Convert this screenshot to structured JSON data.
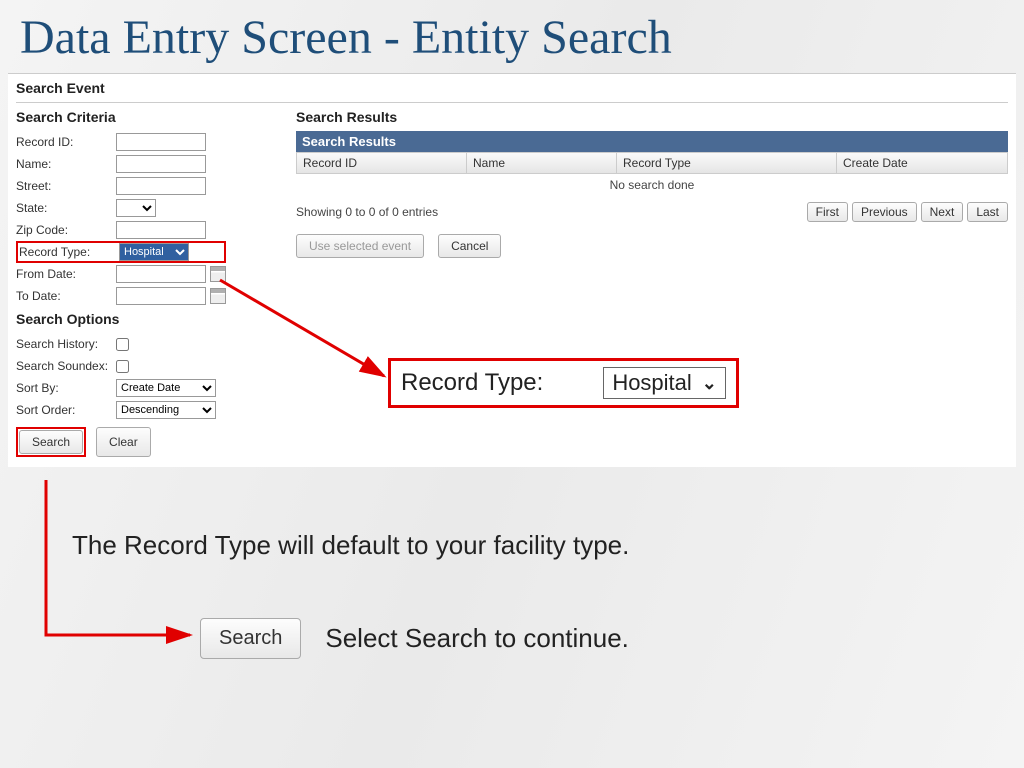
{
  "slide": {
    "title": "Data Entry Screen - Entity Search"
  },
  "panel": {
    "title": "Search Event",
    "criteria": {
      "heading": "Search Criteria",
      "record_id": "Record ID:",
      "name": "Name:",
      "street": "Street:",
      "state": "State:",
      "zip": "Zip Code:",
      "record_type": "Record Type:",
      "record_type_value": "Hospital",
      "from_date": "From Date:",
      "to_date": "To Date:"
    },
    "options": {
      "heading": "Search Options",
      "history": "Search History:",
      "soundex": "Search Soundex:",
      "sort_by": "Sort By:",
      "sort_by_value": "Create Date",
      "sort_order": "Sort Order:",
      "sort_order_value": "Descending"
    },
    "buttons": {
      "search": "Search",
      "clear": "Clear"
    },
    "results": {
      "heading": "Search Results",
      "bar": "Search Results",
      "cols": {
        "id": "Record ID",
        "name": "Name",
        "rt": "Record Type",
        "cd": "Create Date"
      },
      "empty": "No search done",
      "showing": "Showing 0 to 0 of 0 entries",
      "pager": {
        "first": "First",
        "prev": "Previous",
        "next": "Next",
        "last": "Last"
      },
      "use": "Use selected event",
      "cancel": "Cancel"
    }
  },
  "callout": {
    "label": "Record Type:",
    "value": "Hospital"
  },
  "captions": {
    "line1": "The Record Type will default to your facility type.",
    "line2": "Select Search to continue.",
    "search_btn": "Search"
  }
}
